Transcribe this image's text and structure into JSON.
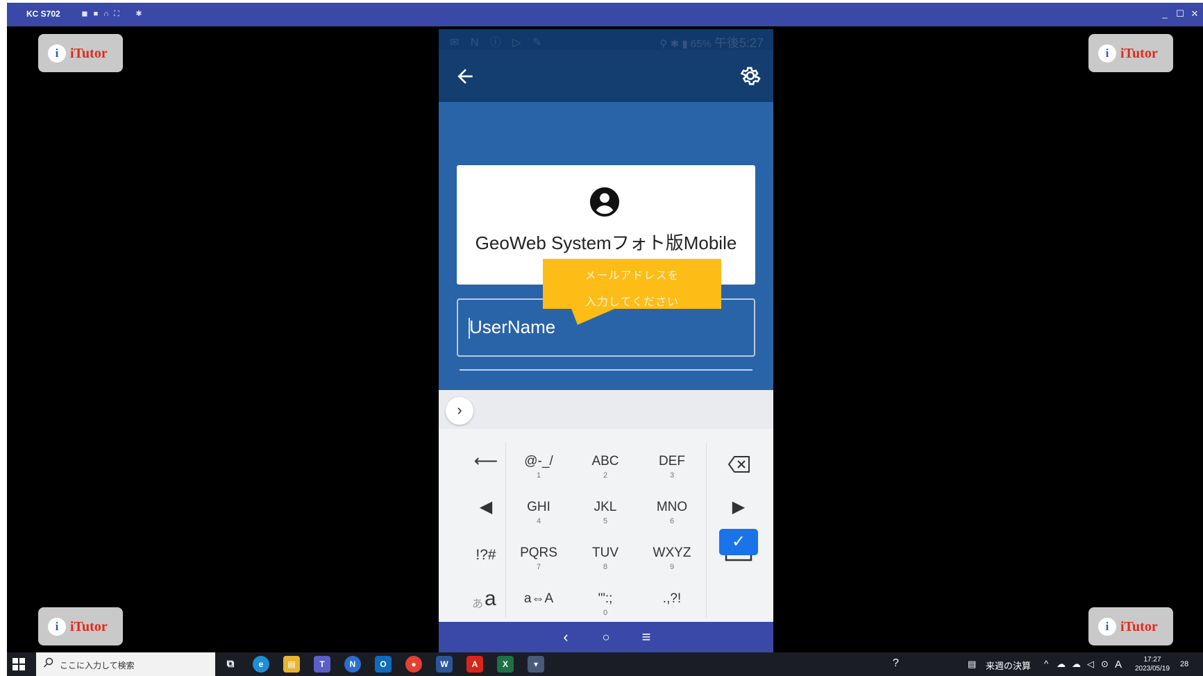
{
  "window": {
    "title": "KC S702",
    "title_icons": [
      "camera-icon",
      "video-icon",
      "headphones-icon",
      "fullscreen-icon",
      "gear-icon"
    ],
    "controls": [
      "minimize",
      "maximize",
      "close"
    ]
  },
  "watermark": {
    "text": "iTutor",
    "icon_letter": "i"
  },
  "phone": {
    "status_bar": {
      "battery": "65%",
      "time": "午後5:27"
    },
    "login_card": {
      "title": "GeoWeb Systemフォト版Mobile"
    },
    "username_field": {
      "placeholder": "UserName",
      "value": ""
    },
    "callout": {
      "line1": "メールアドレスを",
      "line2": "入力してください"
    },
    "keyboard": {
      "rows": [
        [
          {
            "main": "@-_/",
            "sub": "1"
          },
          {
            "main": "ABC",
            "sub": "2"
          },
          {
            "main": "DEF",
            "sub": "3"
          }
        ],
        [
          {
            "main": "GHI",
            "sub": "4"
          },
          {
            "main": "JKL",
            "sub": "5"
          },
          {
            "main": "MNO",
            "sub": "6"
          }
        ],
        [
          {
            "main": "PQRS",
            "sub": "7"
          },
          {
            "main": "TUV",
            "sub": "8"
          },
          {
            "main": "WXYZ",
            "sub": "9"
          }
        ],
        [
          {
            "main": "a⇔A",
            "sub": ""
          },
          {
            "main": "'\":;",
            "sub": "0"
          },
          {
            "main": ".,?!",
            "sub": ""
          }
        ]
      ],
      "symbols_key": "!?#",
      "kana_key_small": "あ",
      "kana_key_large": "a"
    }
  },
  "taskbar": {
    "search_placeholder": "ここに入力して検索",
    "pinned_apps": [
      "task-view",
      "edge",
      "file-explorer",
      "teams",
      "app-n",
      "outlook",
      "chrome",
      "word",
      "acrobat",
      "excel",
      "mirroring-app"
    ],
    "tray_doc": "来週の決算",
    "ime": "A",
    "clock_time": "17:27",
    "clock_date": "2023/05/19",
    "notifications": "28"
  }
}
